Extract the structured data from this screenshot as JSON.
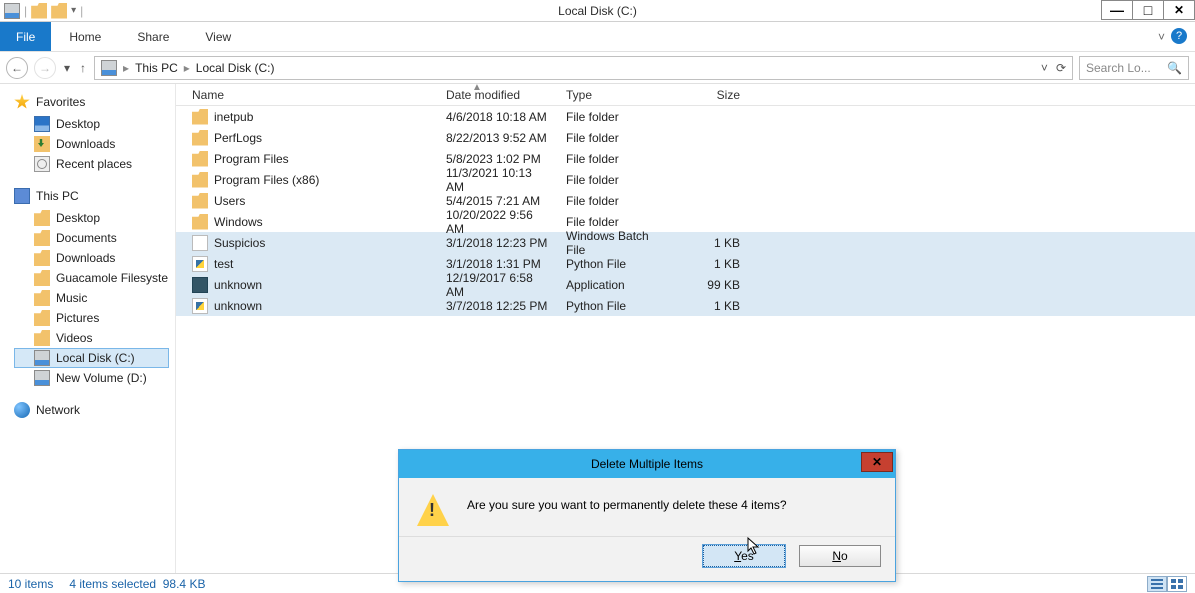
{
  "window": {
    "title": "Local Disk (C:)"
  },
  "winbtns": {
    "min": "—",
    "max": "□",
    "close": "✕"
  },
  "ribbon": {
    "file": "File",
    "tabs": [
      "Home",
      "Share",
      "View"
    ]
  },
  "nav": {
    "back": "←",
    "fwd": "→",
    "down": "▾",
    "up": "↑",
    "crumbs": [
      "This PC",
      "Local Disk (C:)"
    ],
    "refresh": "⟳",
    "search_placeholder": "Search Lo..."
  },
  "tree": {
    "favorites": {
      "label": "Favorites",
      "items": [
        "Desktop",
        "Downloads",
        "Recent places"
      ]
    },
    "thispc": {
      "label": "This PC",
      "items": [
        "Desktop",
        "Documents",
        "Downloads",
        "Guacamole Filesyste",
        "Music",
        "Pictures",
        "Videos",
        "Local Disk (C:)",
        "New Volume (D:)"
      ],
      "selected": "Local Disk (C:)"
    },
    "network": {
      "label": "Network"
    }
  },
  "columns": {
    "name": "Name",
    "date": "Date modified",
    "type": "Type",
    "size": "Size"
  },
  "rows": [
    {
      "icon": "folder",
      "name": "inetpub",
      "date": "4/6/2018 10:18 AM",
      "type": "File folder",
      "size": "",
      "sel": false
    },
    {
      "icon": "folder",
      "name": "PerfLogs",
      "date": "8/22/2013 9:52 AM",
      "type": "File folder",
      "size": "",
      "sel": false
    },
    {
      "icon": "folder",
      "name": "Program Files",
      "date": "5/8/2023 1:02 PM",
      "type": "File folder",
      "size": "",
      "sel": false
    },
    {
      "icon": "folder",
      "name": "Program Files (x86)",
      "date": "11/3/2021 10:13 AM",
      "type": "File folder",
      "size": "",
      "sel": false
    },
    {
      "icon": "folder",
      "name": "Users",
      "date": "5/4/2015 7:21 AM",
      "type": "File folder",
      "size": "",
      "sel": false
    },
    {
      "icon": "folder",
      "name": "Windows",
      "date": "10/20/2022 9:56 AM",
      "type": "File folder",
      "size": "",
      "sel": false
    },
    {
      "icon": "batch",
      "name": "Suspicios",
      "date": "3/1/2018 12:23 PM",
      "type": "Windows Batch File",
      "size": "1 KB",
      "sel": true
    },
    {
      "icon": "py",
      "name": "test",
      "date": "3/1/2018 1:31 PM",
      "type": "Python File",
      "size": "1 KB",
      "sel": true
    },
    {
      "icon": "exe",
      "name": "unknown",
      "date": "12/19/2017 6:58 AM",
      "type": "Application",
      "size": "99 KB",
      "sel": true
    },
    {
      "icon": "py",
      "name": "unknown",
      "date": "3/7/2018 12:25 PM",
      "type": "Python File",
      "size": "1 KB",
      "sel": true
    }
  ],
  "status": {
    "count": "10 items",
    "selected": "4 items selected",
    "size": "98.4 KB"
  },
  "dialog": {
    "title": "Delete Multiple Items",
    "message": "Are you sure you want to permanently delete these 4 items?",
    "yes": "Yes",
    "no": "No"
  }
}
